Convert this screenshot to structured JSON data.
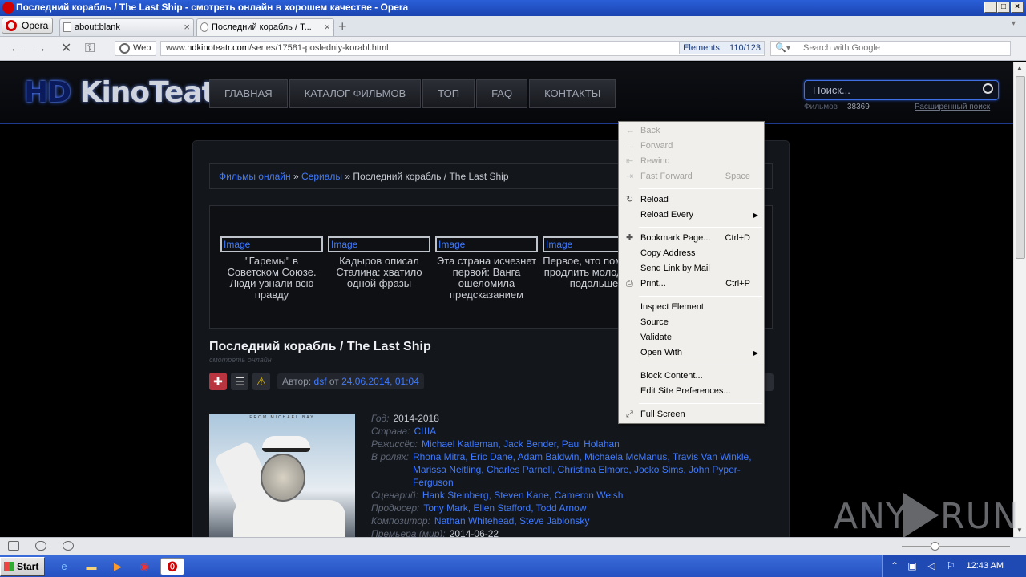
{
  "window": {
    "title": "Последний корабль / The Last Ship - смотреть онлайн в хорошем качестве - Opera"
  },
  "tabs": {
    "opera_menu": "Opera",
    "items": [
      {
        "label": "about:blank"
      },
      {
        "label": "Последний корабль / Т..."
      }
    ],
    "new_tab": "+"
  },
  "nav": {
    "web_badge": "Web",
    "url_prefix": "www.",
    "url_domain": "hdkinoteatr.com",
    "url_path": "/series/17581-posledniy-korabl.html",
    "elements_label": "Elements:",
    "elements_value": "110/123",
    "search_placeholder": "Search with Google"
  },
  "site": {
    "logo_hd": "HD",
    "logo_name": "KinoTeatr",
    "menu": [
      "ГЛАВНАЯ",
      "КАТАЛОГ ФИЛЬМОВ",
      "ТОП",
      "FAQ",
      "КОНТАКТЫ"
    ],
    "search_placeholder": "Поиск...",
    "films_label": "Фильмов",
    "films_count": "38369",
    "advanced_search": "Расширенный поиск"
  },
  "breadcrumb": {
    "home": "Фильмы онлайн",
    "sep1": "»",
    "section": "Сериалы",
    "sep2": "»",
    "current": "Последний корабль / The Last Ship"
  },
  "ads": [
    {
      "img": "Image",
      "caption": "\"Гаремы\" в Советском Союзе. Люди узнали всю правду"
    },
    {
      "img": "Image",
      "caption": "Кадыров описал Сталина: хватило одной фразы"
    },
    {
      "img": "Image",
      "caption": "Эта страна исчезнет первой: Ванга ошеломила предсказанием"
    },
    {
      "img": "Image",
      "caption": "Первое, что поможет продлить молодость подольше"
    }
  ],
  "movie": {
    "title": "Последний корабль / The Last Ship",
    "subtitle": "смотреть онлайн",
    "author_label": "Автор:",
    "author": "dsf",
    "date_from": "от",
    "date": "24.06.2014, 01:04",
    "poster_caption": "FROM MICHAEL BAY",
    "details": [
      {
        "label": "Год:",
        "value": "2014-2018",
        "plain": true
      },
      {
        "label": "Страна:",
        "value": "США"
      },
      {
        "label": "Режиссёр:",
        "value": "Michael Katleman, Jack Bender, Paul Holahan"
      },
      {
        "label": "В ролях:",
        "value": "Rhona Mitra, Eric Dane, Adam Baldwin, Michaela McManus, Travis Van Winkle, Marissa Neitling, Charles Parnell, Christina Elmore, Jocko Sims, John Pyper-Ferguson"
      },
      {
        "label": "Сценарий:",
        "value": "Hank Steinberg, Steven Kane, Cameron Welsh"
      },
      {
        "label": "Продюсер:",
        "value": "Tony Mark, Ellen Stafford, Todd Arnow"
      },
      {
        "label": "Композитор:",
        "value": "Nathan Whitehead, Steve Jablonsky"
      },
      {
        "label": "Премьера (мир):",
        "value": "2014-06-22",
        "plain": true
      }
    ]
  },
  "context_menu": {
    "back": "Back",
    "forward": "Forward",
    "rewind": "Rewind",
    "fast_forward": "Fast Forward",
    "fast_forward_shortcut": "Space",
    "reload": "Reload",
    "reload_every": "Reload Every",
    "bookmark": "Bookmark Page...",
    "bookmark_shortcut": "Ctrl+D",
    "copy_address": "Copy Address",
    "send_link": "Send Link by Mail",
    "print": "Print...",
    "print_shortcut": "Ctrl+P",
    "inspect": "Inspect Element",
    "source": "Source",
    "validate": "Validate",
    "open_with": "Open With",
    "block_content": "Block Content...",
    "edit_prefs": "Edit Site Preferences...",
    "full_screen": "Full Screen"
  },
  "taskbar": {
    "start": "Start",
    "clock": "12:43 AM"
  },
  "watermark": {
    "left": "ANY",
    "right": "RUN"
  }
}
